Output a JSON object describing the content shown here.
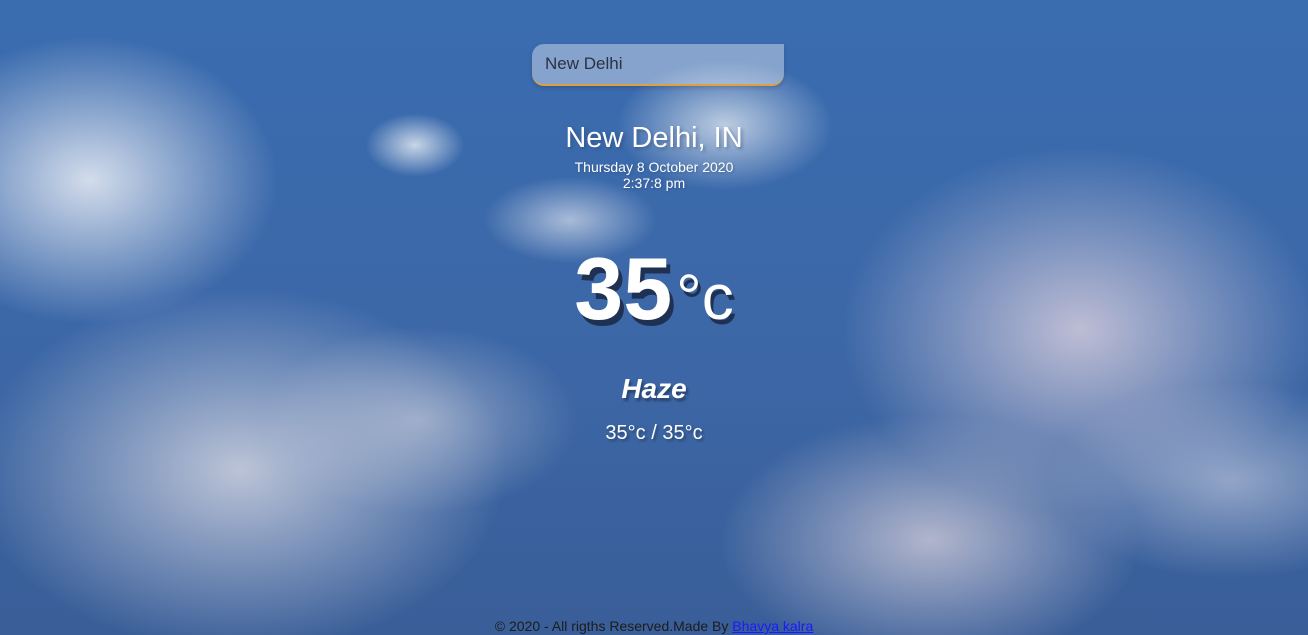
{
  "search": {
    "value": "New Delhi",
    "accent_color": "#e0a040"
  },
  "location": {
    "city_country": "New Delhi, IN",
    "date": "Thursday 8 October 2020",
    "time": "2:37:8 pm"
  },
  "weather": {
    "temperature": "35",
    "unit": "°c",
    "condition": "Haze",
    "hi_low": "35°c / 35°c"
  },
  "footer": {
    "text": "© 2020 - All rigths Reserved.Made By ",
    "author_link": "Bhavya kalra",
    "link_color": "#1a1aff"
  }
}
